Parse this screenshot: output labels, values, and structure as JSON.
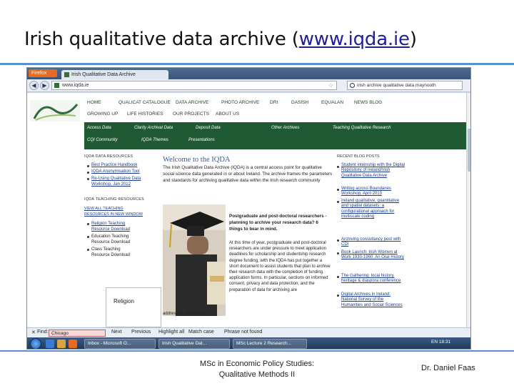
{
  "slide": {
    "title_prefix": "Irish qualitative data archive (",
    "title_link": "www.iqda.ie",
    "title_suffix": ")",
    "footer_center_line1": "MSc in Economic Policy Studies:",
    "footer_center_line2": "Qualitative Methods II",
    "footer_right": "Dr. Daniel Faas"
  },
  "browser": {
    "app_button": "Firefox",
    "tab_label": "Irish Qualitative Data Archive",
    "url": "www.iqda.ie",
    "search_text": "irish archive qualitative data maynooth"
  },
  "site": {
    "menu_row1": [
      "HOME",
      "QUALICAT CATALOGUE",
      "DATA ARCHIVE",
      "PHOTO ARCHIVE",
      "DRI",
      "DASISH",
      "EQUALAN",
      "NEWS BLOG"
    ],
    "menu_row2": [
      "GROWING UP",
      "LIFE HISTORIES",
      "OUR PROJECTS",
      "ABOUT US"
    ],
    "green_row1": [
      "Access Data",
      "Clarity Archival Data",
      "Deposit Data",
      "Other Archives",
      "Teaching Qualitative Research"
    ],
    "green_row2": [
      "CQI Community",
      "IQDA Themes",
      "Presentations"
    ],
    "left_resources_header": "IQDA DATA RESOURCES",
    "left_resources": [
      "Best Practice Handbook",
      "IQDA Anonymisation Tool",
      "Re-Using Qualitative Data Workshop, Jan 2012"
    ],
    "left_teaching_header": "IQDA TEACHING RESOURCES",
    "left_teaching_link": "VIEW ALL TEACHING RESOURCES IN NEW WINDOW",
    "left_teaching_items": [
      "Religion Teaching Resource Download",
      "Education Teaching Resource Download",
      "Class Teaching Resource Download"
    ],
    "religion_label": "Religion",
    "welcome_title": "Welcome to the IQDA",
    "intro_text": "The Irish Qualitative Data Archive (IQDA) is a central access point for qualitative social science data generated in or about Ireland. The archive frames the parameters and standards for archiving qualitative data within the Irish research community",
    "pg_heading": "Postgraduate and post-doctoral researchers - planning to archive your research data? 6 things to bear in mind.",
    "pg_body": "At this time of year, postgraduate and post-doctoral researchers are under pressure to meet application deadlines for scholarship and studentship research degree funding, with the IQDA has put together a short document to assist students that plan to archive their research data with the completion of funding application forms. In particular, sections on informed consent, privacy and data protection, and the preparation of data for archiving are",
    "addressed_text": "addressed. See more ...",
    "right_header": "RECENT BLOG POSTS",
    "blog_posts": [
      "Student internship with the Digital Repository of Ireland/Irish Qualitative Data Archive",
      "Writing across Boundaries Workshop, April 2013",
      "Ireland qualitative, quantitative and spatial datasets: a configurational approach for multiscale coding",
      "Archiving consultancy post with CDI",
      "Book Launch: Irish Women at Work 1930-1960: An Oral History",
      "The Gathering: local history, heritage & diaspora conference",
      "Digital Archives in Ireland: National Survey of the Humanities and Social Sciences"
    ]
  },
  "findbar": {
    "label": "Find:",
    "query": "Chicago",
    "next": "Next",
    "previous": "Previous",
    "highlight": "Highlight all",
    "match_case": "Match case",
    "not_found": "Phrase not found"
  },
  "taskbar": {
    "tasks": [
      "Inbox - Microsoft O...",
      "Irish Qualitative Dat...",
      "MSc Lecture 2 Research..."
    ],
    "tray": "EN 18:31"
  },
  "colors": {
    "rule": "#5a8fd0",
    "site_green": "#1f5a34",
    "link": "#1a3a8a",
    "title_link": "#1f1f99"
  }
}
